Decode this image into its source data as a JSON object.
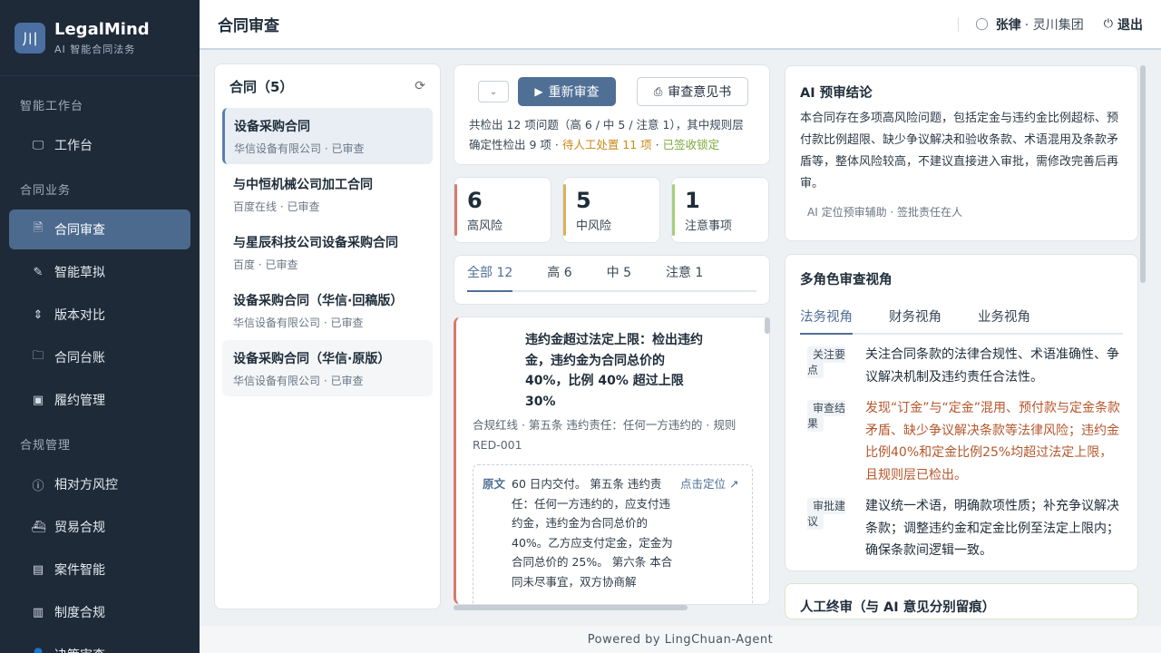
{
  "brand": {
    "logo": "川",
    "title": "LegalMind",
    "subtitle": "AI 智能合同法务"
  },
  "sidebar": {
    "sections": [
      {
        "title": "智能工作台",
        "items": [
          {
            "icon": "monitor-icon",
            "glyph": "🖵",
            "label": "工作台"
          }
        ]
      },
      {
        "title": "合同业务",
        "items": [
          {
            "icon": "document-check-icon",
            "glyph": "🗎",
            "label": "合同审查",
            "active": true
          },
          {
            "icon": "pen-icon",
            "glyph": "✎",
            "label": "智能草拟"
          },
          {
            "icon": "compare-icon",
            "glyph": "⇕",
            "label": "版本对比"
          },
          {
            "icon": "folder-icon",
            "glyph": "🗀",
            "label": "合同台账"
          },
          {
            "icon": "clipboard-icon",
            "glyph": "▣",
            "label": "履约管理"
          }
        ]
      },
      {
        "title": "合规管理",
        "items": [
          {
            "icon": "alert-circle-icon",
            "glyph": "ⓘ",
            "label": "相对方风控"
          },
          {
            "icon": "ship-icon",
            "glyph": "⛴",
            "label": "贸易合规"
          },
          {
            "icon": "case-icon",
            "glyph": "▤",
            "label": "案件智能"
          },
          {
            "icon": "building-icon",
            "glyph": "▥",
            "label": "制度合规"
          },
          {
            "icon": "person-icon",
            "glyph": "👤",
            "label": "决策审查"
          }
        ]
      }
    ]
  },
  "header": {
    "title": "合同审查",
    "user_name": "张律",
    "user_org": "· 灵川集团",
    "logout": "退出"
  },
  "contracts": {
    "title": "合同（5）",
    "items": [
      {
        "name": "设备采购合同",
        "meta": "华信设备有限公司 · 已审查"
      },
      {
        "name": "与中恒机械公司加工合同",
        "meta": "百度在线 · 已审查"
      },
      {
        "name": "与星辰科技公司设备采购合同",
        "meta": "百度 · 已审查"
      },
      {
        "name": "设备采购合同（华信·回稿版）",
        "meta": "华信设备有限公司 · 已审查"
      },
      {
        "name": "设备采购合同（华信·原版）",
        "meta": "华信设备有限公司 · 已审查"
      }
    ]
  },
  "toolbar": {
    "recheck": "重新审查",
    "opinion": "审查意见书",
    "summary_a": "共检出 12 项问题（高 6 / 中 5 / 注意 1），其中规则层确定性检出 9 项 · ",
    "summary_pending": "待人工处置 11 项",
    "summary_sep": " · ",
    "summary_locked": "已签收锁定"
  },
  "stats": [
    {
      "num": "6",
      "label": "高风险"
    },
    {
      "num": "5",
      "label": "中风险"
    },
    {
      "num": "1",
      "label": "注意事项"
    }
  ],
  "filters": [
    "全部 12",
    "高 6",
    "中 5",
    "注意 1"
  ],
  "issue": {
    "title": "违约金超过法定上限：检出违约金，违约金为合同总价的 40%，比例 40% 超过上限 30%",
    "meta": "合规红线 · 第五条 违约责任：任何一方违约的 · 规则 RED-001",
    "quote_tag": "原文",
    "quote": "60 日内交付。 第五条 违约责任：任何一方违约的，应支付违约金，违约金为合同总价的 40%。乙方应支付定金，定金为合同总价的 25%。 第六条 本合同未尽事宜，双方协商解",
    "locate": "点击定位 ↗"
  },
  "ai": {
    "title": "AI 预审结论",
    "text": "本合同存在多项高风险问题，包括定金与违约金比例超标、预付款比例超限、缺少争议解决和验收条款、术语混用及条款矛盾等，整体风险较高，不建议直接进入审批，需修改完善后再审。",
    "foot": "AI 定位预审辅助 · 签批责任在人"
  },
  "roles": {
    "title": "多角色审查视角",
    "tabs": [
      "法务视角",
      "财务视角",
      "业务视角"
    ],
    "rows": [
      {
        "label": "关注要点",
        "text": "关注合同条款的法律合规性、术语准确性、争议解决机制及违约责任合法性。"
      },
      {
        "label": "审查结果",
        "text": "发现“订金”与“定金”混用、预付款与定金条款矛盾、缺少争议解决条款等法律风险；违约金比例40%和定金比例25%均超过法定上限，且规则层已检出。"
      },
      {
        "label": "审批建议",
        "text": "建议统一术语，明确款项性质；补充争议解决条款；调整违约金和定金比例至法定上限内；确保条款间逻辑一致。"
      }
    ]
  },
  "final_review": {
    "title": "人工终审（与 AI 意见分别留痕）"
  },
  "footer": "Powered by LingChuan-Agent"
}
